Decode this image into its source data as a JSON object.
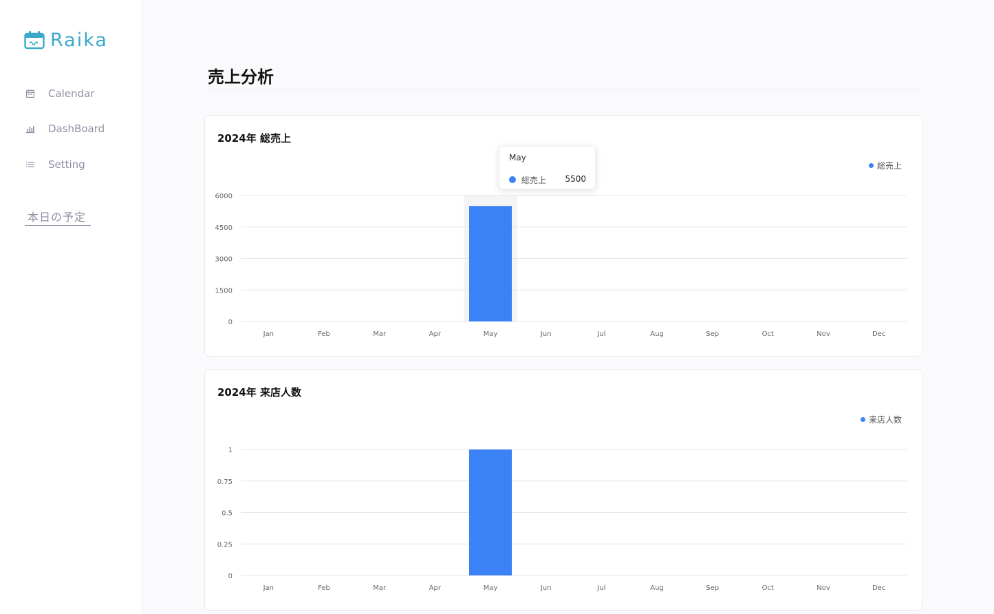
{
  "app": {
    "name": "Raika"
  },
  "sidebar": {
    "items": [
      {
        "label": "Calendar",
        "icon": "calendar-icon"
      },
      {
        "label": "DashBoard",
        "icon": "bar-chart-icon"
      },
      {
        "label": "Setting",
        "icon": "list-icon"
      }
    ],
    "today_label": "本日の予定"
  },
  "main": {
    "title": "売上分析"
  },
  "colors": {
    "accent": "#3b82f6",
    "brand": "#3aaac8",
    "nav_text": "#8e8fa6"
  },
  "tooltip": {
    "title": "May",
    "series_name": "総売上",
    "value": "5500"
  },
  "chart_data": [
    {
      "type": "bar",
      "title": "2024年 総売上",
      "categories": [
        "Jan",
        "Feb",
        "Mar",
        "Apr",
        "May",
        "Jun",
        "Jul",
        "Aug",
        "Sep",
        "Oct",
        "Nov",
        "Dec"
      ],
      "series": [
        {
          "name": "総売上",
          "values": [
            0,
            0,
            0,
            0,
            5500,
            0,
            0,
            0,
            0,
            0,
            0,
            0
          ]
        }
      ],
      "yticks": [
        "0",
        "1500",
        "3000",
        "4500",
        "6000"
      ],
      "ylim": [
        0,
        6000
      ],
      "grid": true,
      "legend": "top-right",
      "highlight_category": "May"
    },
    {
      "type": "bar",
      "title": "2024年 来店人数",
      "categories": [
        "Jan",
        "Feb",
        "Mar",
        "Apr",
        "May",
        "Jun",
        "Jul",
        "Aug",
        "Sep",
        "Oct",
        "Nov",
        "Dec"
      ],
      "series": [
        {
          "name": "来店人数",
          "values": [
            0,
            0,
            0,
            0,
            1,
            0,
            0,
            0,
            0,
            0,
            0,
            0
          ]
        }
      ],
      "yticks": [
        "0",
        "0.25",
        "0.5",
        "0.75",
        "1"
      ],
      "ylim": [
        0,
        1
      ],
      "grid": true,
      "legend": "top-right"
    }
  ]
}
